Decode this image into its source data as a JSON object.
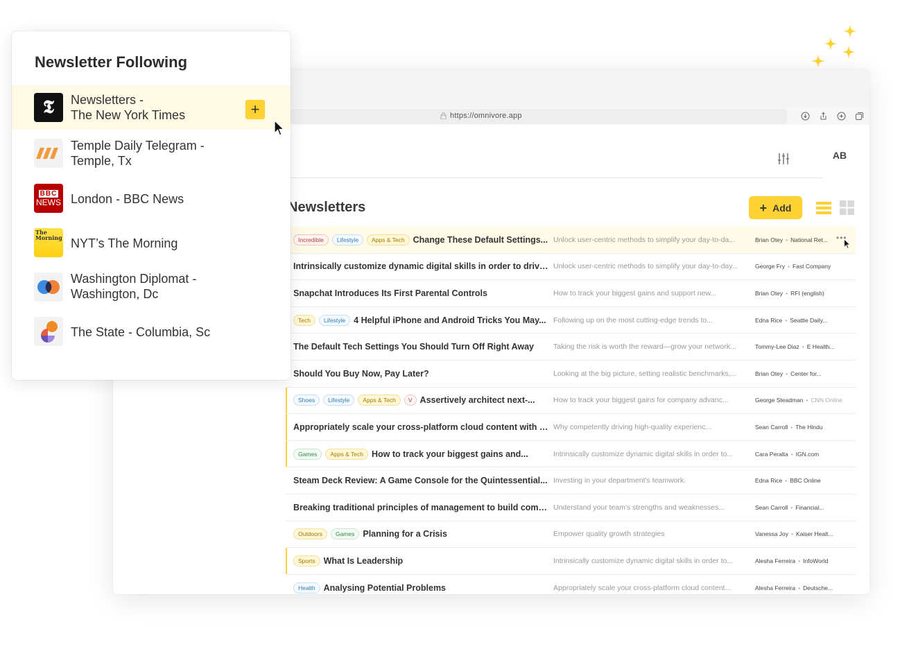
{
  "browser": {
    "url": "https://omnivore.app"
  },
  "app": {
    "avatar_initials": "AB",
    "section_title": "Newsletters",
    "add_label": "Add"
  },
  "articles": [
    {
      "tags": [
        {
          "label": "Incredible",
          "color": "red"
        },
        {
          "label": "Lifestyle",
          "color": "blue"
        },
        {
          "label": "Apps & Tech",
          "color": "yellow"
        }
      ],
      "title": "Change These Default Settings...",
      "desc": "Unlock user-centric methods to simplify your day-to-da...",
      "author": "Brian Otey",
      "source": "National Ret...",
      "highlight": true,
      "marked": false
    },
    {
      "tags": [],
      "title": "Intrinsically customize dynamic digital skills in order to drive...",
      "desc": "Unlock user-centric methods to simplify your day-to-day...",
      "author": "George Fry",
      "source": "Fast Company",
      "highlight": false,
      "marked": false
    },
    {
      "tags": [],
      "title": "Snapchat Introduces Its First Parental Controls",
      "desc": "How to track your biggest gains and support new...",
      "author": "Brian Otey",
      "source": "RFI (english)",
      "highlight": false,
      "marked": false
    },
    {
      "tags": [
        {
          "label": "Tech",
          "color": "yellow"
        },
        {
          "label": "Lifestyle",
          "color": "blue"
        }
      ],
      "title": "4 Helpful iPhone and Android Tricks You May...",
      "desc": "Following up on the most cutting-edge trends to...",
      "author": "Edna Rice",
      "source": "Seattle Daily...",
      "highlight": false,
      "marked": false
    },
    {
      "tags": [],
      "title": "The Default Tech Settings You Should Turn Off Right Away",
      "desc": "Taking the risk is worth the reward—grow your network...",
      "author": "Tommy-Lee Diaz",
      "source": "E Health...",
      "highlight": false,
      "marked": false
    },
    {
      "tags": [],
      "title": "Should You Buy Now, Pay Later?",
      "desc": "Looking at the big picture, setting realistic benchmarks,...",
      "author": "Brian Otey",
      "source": "Center for...",
      "highlight": false,
      "marked": false
    },
    {
      "tags": [
        {
          "label": "Shoes",
          "color": "blue"
        },
        {
          "label": "Lifestyle",
          "color": "blue"
        },
        {
          "label": "Apps & Tech",
          "color": "yellow"
        },
        {
          "label": "V",
          "color": "purple"
        }
      ],
      "title": "Assertively architect next-...",
      "desc": "How to track your biggest gains for company advanc...",
      "author": "George Steadman",
      "source": "CNN Online",
      "highlight": false,
      "marked": true,
      "source_muted": true
    },
    {
      "tags": [],
      "title": "Appropriately scale your cross-platform cloud content with ou...",
      "desc": "Why competently driving high-quality experienc...",
      "author": "Sean Carroll",
      "source": "The Hindu",
      "highlight": false,
      "marked": true
    },
    {
      "tags": [
        {
          "label": "Games",
          "color": "green"
        },
        {
          "label": "Apps & Tech",
          "color": "yellow"
        }
      ],
      "title": "How to track your biggest gains and...",
      "desc": "Intrinsically customize dynamic digital skills in order to...",
      "author": "Cara Peralta",
      "source": "IGN.com",
      "highlight": false,
      "marked": true
    },
    {
      "tags": [],
      "title": "Steam Deck Review: A Game Console for the Quintessential...",
      "desc": "Investing in your department's teamwork.",
      "author": "Edna Rice",
      "source": "BBC Online",
      "highlight": false,
      "marked": false
    },
    {
      "tags": [],
      "title": "Breaking traditional principles of management to build compa...",
      "desc": "Understand your team's strengths and weaknesses...",
      "author": "Sean Carroll",
      "source": "Financial...",
      "highlight": false,
      "marked": false
    },
    {
      "tags": [
        {
          "label": "Outdoors",
          "color": "yellow"
        },
        {
          "label": "Games",
          "color": "green"
        }
      ],
      "title": "Planning for a Crisis",
      "desc": "Empower quality growth strategies",
      "author": "Vanessa Joy",
      "source": "Kaiser Healt...",
      "highlight": false,
      "marked": false
    },
    {
      "tags": [
        {
          "label": "Sports",
          "color": "yellow"
        }
      ],
      "title": "What Is Leadership",
      "desc": "Intrinsically customize dynamic digital skills in order to...",
      "author": "Alesha Ferreira",
      "source": "InfoWorld",
      "highlight": false,
      "marked": true
    },
    {
      "tags": [
        {
          "label": "Health",
          "color": "blue"
        }
      ],
      "title": "Analysing Potential Problems",
      "desc": "Appropriately scale your cross-platform cloud content...",
      "author": "Alesha Ferreira",
      "source": "Deutsche...",
      "highlight": false,
      "marked": false
    }
  ],
  "panel": {
    "title": "Newsletter Following",
    "add_symbol": "+",
    "items": [
      {
        "name_line1": "Newsletters -",
        "name_line2": "The New York Times",
        "logo": "nyt-logo"
      },
      {
        "name_line1": "Temple Daily Telegram -",
        "name_line2": "Temple, Tx",
        "logo": "temple-logo"
      },
      {
        "name_line1": "London - BBC News",
        "name_line2": "",
        "logo": "bbc-news-logo",
        "logo_text_top": "BBC",
        "logo_text_bottom": "NEWS"
      },
      {
        "name_line1": "NYT’s The Morning",
        "name_line2": "",
        "logo": "the-morning-logo",
        "logo_text": "The Morning"
      },
      {
        "name_line1": "Washington Diplomat -",
        "name_line2": "Washington, Dc",
        "logo": "washington-diplomat-logo"
      },
      {
        "name_line1": "The State - Columbia, Sc",
        "name_line2": "",
        "logo": "the-state-logo"
      }
    ]
  },
  "colors": {
    "accent": "#ffd234",
    "highlight_row": "#fffbe8"
  }
}
